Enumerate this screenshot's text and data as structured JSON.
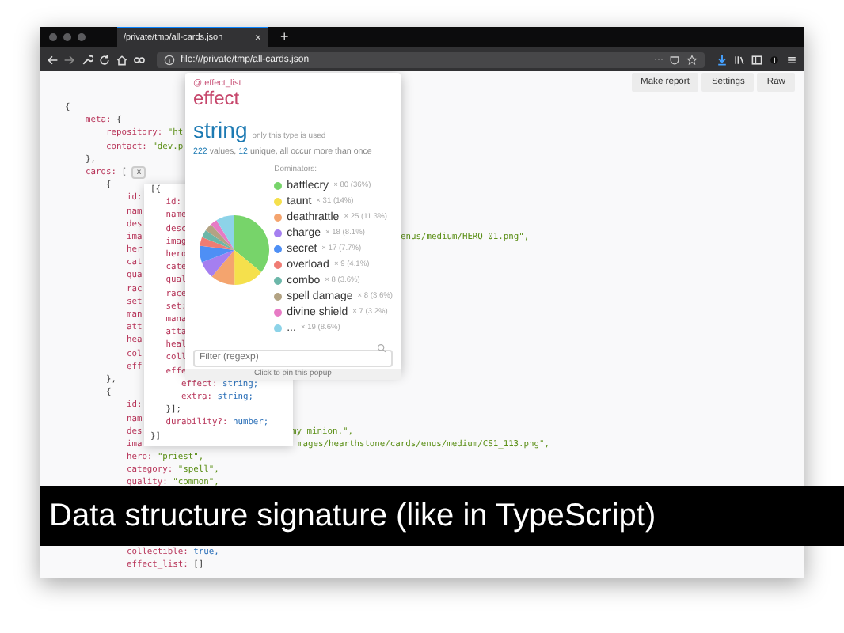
{
  "window": {
    "tab_title": "/private/tmp/all-cards.json",
    "tab_close": "×",
    "new_tab": "+",
    "url": "file:///private/tmp/all-cards.json",
    "overflow_menu": "···"
  },
  "toolbar_buttons": [
    "Make report",
    "Settings",
    "Raw"
  ],
  "code_lines": [
    {
      "text": "{"
    },
    {
      "key": "    meta:",
      "text": "{"
    },
    {
      "key": "        repository:",
      "string_value": "\"ht"
    },
    {
      "key": "        contact:",
      "string_value": "\"dev.p"
    },
    {
      "text": "    },"
    },
    {
      "key": "    cards:",
      "text": "[",
      "pill": "x"
    },
    {
      "text": "        {"
    },
    {
      "key": "            id:"
    },
    {
      "key": "            nam"
    },
    {
      "key": "            des"
    },
    {
      "key": "            ima",
      "tail": "enus/medium/HERO_01.png\","
    },
    {
      "key": "            her"
    },
    {
      "key": "            cat"
    },
    {
      "key": "            qua"
    },
    {
      "key": "            rac"
    },
    {
      "key": "            set"
    },
    {
      "key": "            man"
    },
    {
      "key": "            att"
    },
    {
      "key": "            hea"
    },
    {
      "key": "            col"
    },
    {
      "key": "            eff"
    },
    {
      "text": "        },"
    },
    {
      "text": "        {"
    },
    {
      "key": "            id:"
    },
    {
      "key": "            nam"
    },
    {
      "key": "            des",
      "tail": "my minion.\","
    },
    {
      "key": "            ima",
      "tail": "mages/hearthstone/cards/enus/medium/CS1_113.png\","
    },
    {
      "key": "            hero:",
      "string_value": "\"priest\","
    },
    {
      "key": "            category:",
      "string_value": "\"spell\","
    },
    {
      "key": "            quality:",
      "string_value": "\"common\","
    }
  ],
  "code_lines_after_caption": [
    {
      "key": "            collectible:",
      "literal_value": "true,"
    },
    {
      "key": "            effect_list:",
      "text": "[]"
    }
  ],
  "signature_popup": {
    "lines": [
      {
        "text": "[{"
      },
      {
        "key": "   id:"
      },
      {
        "key": "   name"
      },
      {
        "key": "   desc"
      },
      {
        "key": "   imag"
      },
      {
        "key": "   hero"
      },
      {
        "key": "   cate"
      },
      {
        "key": "   qual"
      },
      {
        "key": "   race"
      },
      {
        "key": "   set:"
      },
      {
        "key": "   mana"
      },
      {
        "key": "   atta"
      },
      {
        "key": "   heal"
      },
      {
        "key": "   coll"
      },
      {
        "key": "   effe"
      },
      {
        "key": "      effect:",
        "type_value": "string;"
      },
      {
        "key": "      extra:",
        "type_value": "string;"
      },
      {
        "text": "   }];"
      },
      {
        "key": "   durability?:",
        "type_value": "number;"
      },
      {
        "text": "}]"
      }
    ]
  },
  "effect_popup": {
    "path": "@.effect_list",
    "name": "effect",
    "type": "string",
    "type_note": "only this type is used",
    "stats": [
      {
        "text": "222",
        "kind": "number"
      },
      {
        "text": " values, ",
        "kind": "plain"
      },
      {
        "text": "12",
        "kind": "number"
      },
      {
        "text": " unique, all occur more than once",
        "kind": "plain"
      }
    ],
    "dominators_label": "Dominators:",
    "dominators": [
      {
        "count": "× 80 (36%)",
        "color": "#77d46a"
      },
      {
        "count": "× 31 (14%)",
        "color": "#f5e04c"
      },
      {
        "count": "× 25 (11.3%)",
        "color": "#f4a46e"
      },
      {
        "count": "× 18 (8.1%)",
        "color": "#a57ff0"
      },
      {
        "count": "× 17 (7.7%)",
        "color": "#4e8ff5"
      },
      {
        "count": "× 9 (4.1%)",
        "color": "#f07c74"
      },
      {
        "count": "× 8 (3.6%)",
        "color": "#6cb7a9"
      },
      {
        "count": "× 8 (3.6%)",
        "color": "#b3a383"
      },
      {
        "count": "× 7 (3.2%)",
        "color": "#e77bc5"
      },
      {
        "count": "× 19 (8.6%)",
        "color": "#8dd3e8"
      }
    ],
    "chart_data": {
      "type": "pie",
      "categories": [
        "battlecry",
        "taunt",
        "deathrattle",
        "charge",
        "secret",
        "overload",
        "combo",
        "spell damage",
        "divine shield",
        "..."
      ],
      "values": [
        36,
        14,
        11.3,
        8.1,
        7.7,
        4.1,
        3.6,
        3.6,
        3.2,
        8.6
      ]
    },
    "filter_placeholder": "Filter (regexp)",
    "footer": "Click to pin this popup"
  },
  "caption": "Data structure signature (like in TypeScript)"
}
